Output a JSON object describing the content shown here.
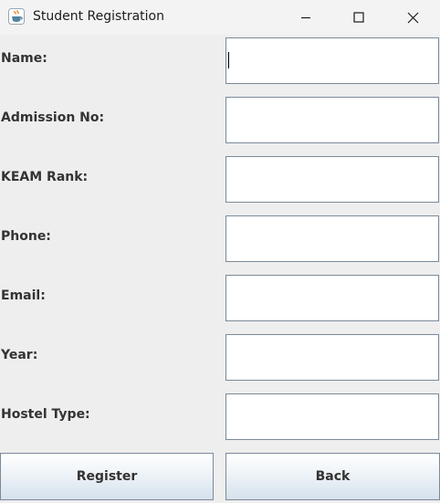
{
  "window": {
    "title": "Student Registration",
    "icon": "java-cup-icon",
    "controls": [
      "minimize-icon",
      "maximize-icon",
      "close-icon"
    ]
  },
  "form": {
    "fields": [
      {
        "label": "Name:",
        "value": "",
        "placeholder": ""
      },
      {
        "label": "Admission No:",
        "value": "",
        "placeholder": ""
      },
      {
        "label": "KEAM Rank:",
        "value": "",
        "placeholder": ""
      },
      {
        "label": "Phone:",
        "value": "",
        "placeholder": ""
      },
      {
        "label": "Email:",
        "value": "",
        "placeholder": ""
      },
      {
        "label": "Year:",
        "value": "",
        "placeholder": ""
      },
      {
        "label": "Hostel Type:",
        "value": "",
        "placeholder": ""
      }
    ],
    "buttons": {
      "register": "Register",
      "back": "Back"
    }
  },
  "colors": {
    "window_background": "#eeeeee",
    "titlebar_background": "#f3f3f3",
    "field_border": "#7a8a99",
    "label_text": "#333333"
  }
}
